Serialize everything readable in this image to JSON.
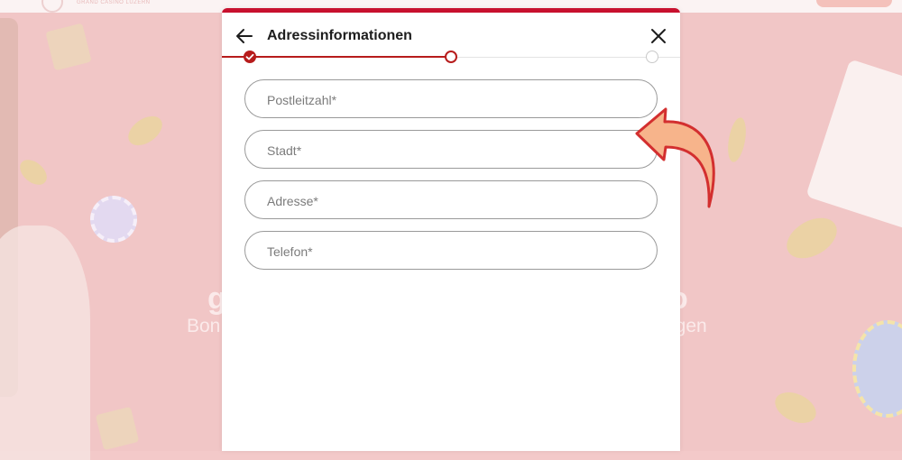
{
  "background": {
    "logo_text": "GRAND CASINO LUZERN",
    "hero_left_title": "g",
    "hero_left_sub": "Bon",
    "hero_right_title": "o",
    "hero_right_sub": "ngen"
  },
  "modal": {
    "title": "Adressinformationen",
    "steps": {
      "total": 3,
      "current": 2
    }
  },
  "form": {
    "fields": [
      {
        "placeholder": "Postleitzahl*",
        "value": ""
      },
      {
        "placeholder": "Stadt*",
        "value": ""
      },
      {
        "placeholder": "Adresse*",
        "value": ""
      },
      {
        "placeholder": "Telefon*",
        "value": ""
      }
    ]
  },
  "colors": {
    "accent": "#c8102e",
    "step_active": "#b71c1c",
    "overlay_bg": "#f1c6c6",
    "arrow_fill": "#f7b48b",
    "arrow_stroke": "#d32f2f"
  },
  "icons": {
    "back": "arrow-left-icon",
    "close": "close-icon",
    "step_done": "check-icon"
  }
}
